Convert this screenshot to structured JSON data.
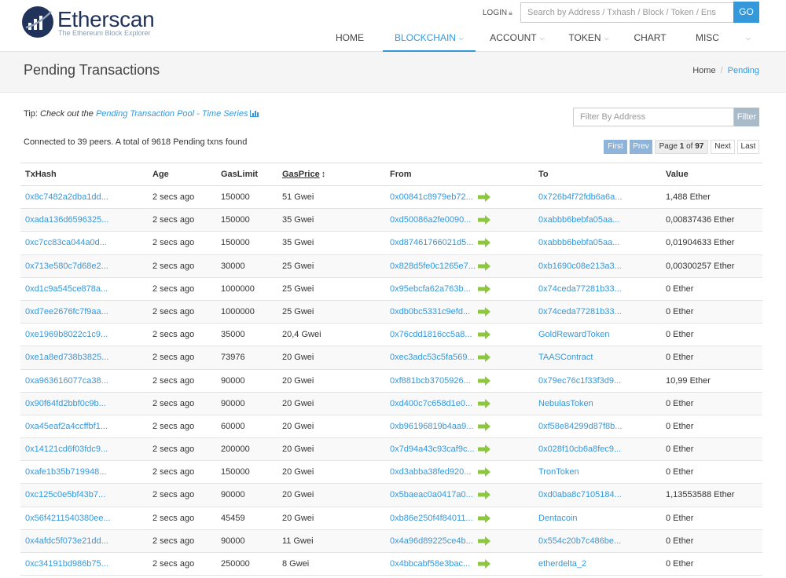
{
  "header": {
    "brand": "Etherscan",
    "tagline": "The Ethereum Block Explorer",
    "login_label": "LOGIN",
    "search_placeholder": "Search by Address / Txhash / Block / Token / Ens",
    "go_label": "GO",
    "nav": [
      {
        "label": "HOME",
        "active": false,
        "dropdown": false
      },
      {
        "label": "BLOCKCHAIN",
        "active": true,
        "dropdown": true
      },
      {
        "label": "ACCOUNT",
        "active": false,
        "dropdown": true
      },
      {
        "label": "TOKEN",
        "active": false,
        "dropdown": true
      },
      {
        "label": "CHART",
        "active": false,
        "dropdown": false
      },
      {
        "label": "MISC",
        "active": false,
        "dropdown": true
      }
    ]
  },
  "page": {
    "title": "Pending Transactions",
    "breadcrumb": {
      "home": "Home",
      "sep": "/",
      "current": "Pending"
    }
  },
  "tip": {
    "prefix": "Tip:",
    "text": "Check out the",
    "link": "Pending Transaction Pool - Time Series"
  },
  "filter": {
    "placeholder": "Filter By Address",
    "button": "Filter"
  },
  "status": "Connected to 39 peers. A total of 9618 Pending txns found",
  "pager": {
    "first": "First",
    "prev": "Prev",
    "page_prefix": "Page",
    "current": "1",
    "of": "of",
    "total": "97",
    "next": "Next",
    "last": "Last"
  },
  "columns": [
    "TxHash",
    "Age",
    "GasLimit",
    "GasPrice",
    "From",
    "To",
    "Value"
  ],
  "rows": [
    {
      "hash": "0x8c7482a2dba1dd...",
      "age": "2 secs ago",
      "gaslimit": "150000",
      "gasprice": "51 Gwei",
      "from": "0x00841c8979eb72...",
      "to": "0x726b4f72fdb6a6a...",
      "value": "1,488 Ether"
    },
    {
      "hash": "0xada136d6596325...",
      "age": "2 secs ago",
      "gaslimit": "150000",
      "gasprice": "35 Gwei",
      "from": "0xd50086a2fe0090...",
      "to": "0xabbb6bebfa05aa...",
      "value": "0,00837436 Ether"
    },
    {
      "hash": "0xc7cc83ca044a0d...",
      "age": "2 secs ago",
      "gaslimit": "150000",
      "gasprice": "35 Gwei",
      "from": "0xd87461766021d5...",
      "to": "0xabbb6bebfa05aa...",
      "value": "0,01904633 Ether"
    },
    {
      "hash": "0x713e580c7d68e2...",
      "age": "2 secs ago",
      "gaslimit": "30000",
      "gasprice": "25 Gwei",
      "from": "0x828d5fe0c1265e7...",
      "to": "0xb1690c08e213a3...",
      "value": "0,00300257 Ether"
    },
    {
      "hash": "0xd1c9a545ce878a...",
      "age": "2 secs ago",
      "gaslimit": "1000000",
      "gasprice": "25 Gwei",
      "from": "0x95ebcfa62a763b...",
      "to": "0x74ceda77281b33...",
      "value": "0 Ether"
    },
    {
      "hash": "0xd7ee2676fc7f9aa...",
      "age": "2 secs ago",
      "gaslimit": "1000000",
      "gasprice": "25 Gwei",
      "from": "0xdb0bc5331c9efd...",
      "to": "0x74ceda77281b33...",
      "value": "0 Ether"
    },
    {
      "hash": "0xe1969b8022c1c9...",
      "age": "2 secs ago",
      "gaslimit": "35000",
      "gasprice": "20,4 Gwei",
      "from": "0x76cdd1816cc5a8...",
      "to": "GoldRewardToken",
      "value": "0 Ether"
    },
    {
      "hash": "0xe1a8ed738b3825...",
      "age": "2 secs ago",
      "gaslimit": "73976",
      "gasprice": "20 Gwei",
      "from": "0xec3adc53c5fa569...",
      "to": "TAASContract",
      "value": "0 Ether"
    },
    {
      "hash": "0xa963616077ca38...",
      "age": "2 secs ago",
      "gaslimit": "90000",
      "gasprice": "20 Gwei",
      "from": "0xf881bcb3705926...",
      "to": "0x79ec76c1f33f3d9...",
      "value": "10,99 Ether"
    },
    {
      "hash": "0x90f64fd2bbf0c9b...",
      "age": "2 secs ago",
      "gaslimit": "90000",
      "gasprice": "20 Gwei",
      "from": "0xd400c7c658d1e0...",
      "to": "NebulasToken",
      "value": "0 Ether"
    },
    {
      "hash": "0xa45eaf2a4ccffbf1...",
      "age": "2 secs ago",
      "gaslimit": "60000",
      "gasprice": "20 Gwei",
      "from": "0xb96196819b4aa9...",
      "to": "0xf58e84299d87f8b...",
      "value": "0 Ether"
    },
    {
      "hash": "0x14121cd6f03fdc9...",
      "age": "2 secs ago",
      "gaslimit": "200000",
      "gasprice": "20 Gwei",
      "from": "0x7d94a43c93caf9c...",
      "to": "0x028f10cb6a8fec9...",
      "value": "0 Ether"
    },
    {
      "hash": "0xafe1b35b719948...",
      "age": "2 secs ago",
      "gaslimit": "150000",
      "gasprice": "20 Gwei",
      "from": "0xd3abba38fed920...",
      "to": "TronToken",
      "value": "0 Ether"
    },
    {
      "hash": "0xc125c0e5bf43b7...",
      "age": "2 secs ago",
      "gaslimit": "90000",
      "gasprice": "20 Gwei",
      "from": "0x5baeac0a0417a0...",
      "to": "0xd0aba8c7105184...",
      "value": "1,13553588 Ether"
    },
    {
      "hash": "0x56f4211540380ee...",
      "age": "2 secs ago",
      "gaslimit": "45459",
      "gasprice": "20 Gwei",
      "from": "0xb86e250f4f84011...",
      "to": "Dentacoin",
      "value": "0 Ether"
    },
    {
      "hash": "0x4afdc5f073e21dd...",
      "age": "2 secs ago",
      "gaslimit": "90000",
      "gasprice": "11 Gwei",
      "from": "0x4a96d89225ce4b...",
      "to": "0x554c20b7c486be...",
      "value": "0 Ether"
    },
    {
      "hash": "0xc34191bd986b75...",
      "age": "2 secs ago",
      "gaslimit": "250000",
      "gasprice": "8 Gwei",
      "from": "0x4bbcabf58e3bac...",
      "to": "etherdelta_2",
      "value": "0 Ether"
    }
  ],
  "colors": {
    "accent": "#3498db",
    "brand": "#21325b",
    "arrow": "#8dc63f"
  },
  "icons": {
    "logo": "etherscan-logo-icon",
    "lock": "lock-icon",
    "sort": "sort-icon",
    "arrow": "transfer-arrow-icon",
    "caret": "chevron-down-icon",
    "chart": "bar-chart-icon"
  }
}
